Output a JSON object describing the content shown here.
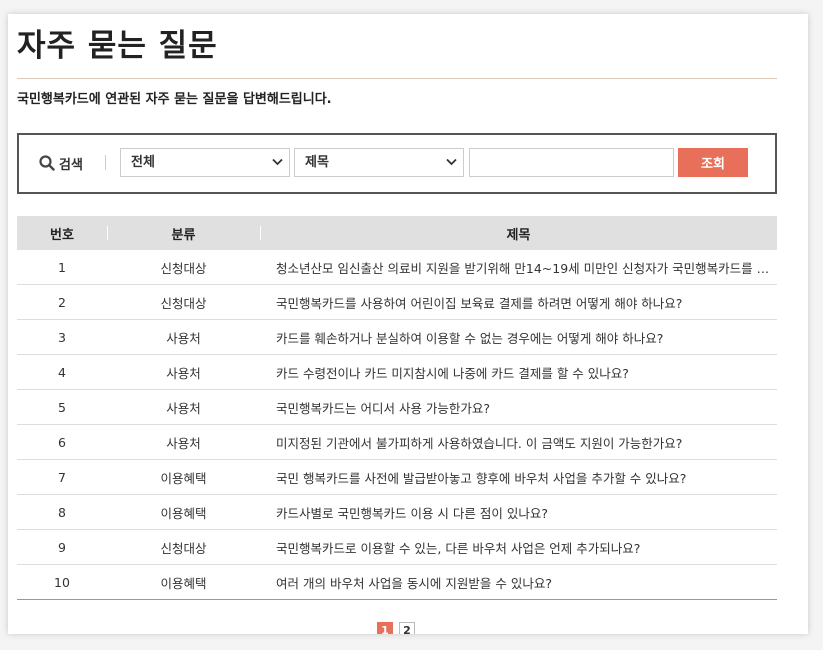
{
  "page": {
    "title": "자주 묻는 질문",
    "subtitle": "국민행복카드에 연관된 자주 묻는 질문을 답변해드립니다."
  },
  "search": {
    "label": "검색",
    "icon": "search-icon",
    "category_selected": "전체",
    "field_selected": "제목",
    "input_value": "",
    "button_label": "조회"
  },
  "table": {
    "headers": {
      "number": "번호",
      "category": "분류",
      "subject": "제목"
    },
    "rows": [
      {
        "number": "1",
        "category": "신청대상",
        "subject": "청소년산모 임신출산 의료비 지원을 받기위해 만14~19세 미만인 신청자가 국민행복카드를 신청하려면 어떻게 해야 하나요?"
      },
      {
        "number": "2",
        "category": "신청대상",
        "subject": "국민행복카드를 사용하여 어린이집 보육료 결제를 하려면 어떻게 해야 하나요?"
      },
      {
        "number": "3",
        "category": "사용처",
        "subject": "카드를 훼손하거나 분실하여 이용할 수 없는 경우에는 어떻게 해야 하나요?"
      },
      {
        "number": "4",
        "category": "사용처",
        "subject": "카드 수령전이나 카드 미지참시에 나중에 카드 결제를 할 수 있나요?"
      },
      {
        "number": "5",
        "category": "사용처",
        "subject": "국민행복카드는 어디서 사용 가능한가요?"
      },
      {
        "number": "6",
        "category": "사용처",
        "subject": "미지정된 기관에서 불가피하게 사용하였습니다. 이 금액도 지원이 가능한가요?"
      },
      {
        "number": "7",
        "category": "이용혜택",
        "subject": "국민 행복카드를 사전에 발급받아놓고 향후에 바우처 사업을 추가할 수 있나요?"
      },
      {
        "number": "8",
        "category": "이용혜택",
        "subject": "카드사별로 국민행복카드 이용 시 다른 점이 있나요?"
      },
      {
        "number": "9",
        "category": "신청대상",
        "subject": "국민행복카드로 이용할 수 있는, 다른 바우처 사업은 언제 추가되나요?"
      },
      {
        "number": "10",
        "category": "이용혜택",
        "subject": "여러 개의 바우처 사업을 동시에 지원받을 수 있나요?"
      }
    ]
  },
  "pagination": {
    "pages": [
      "1",
      "2"
    ],
    "current": "1"
  },
  "colors": {
    "accent": "#e8705a",
    "header_bg": "#e0e0e0",
    "title_rule": "#dcc9b8"
  }
}
